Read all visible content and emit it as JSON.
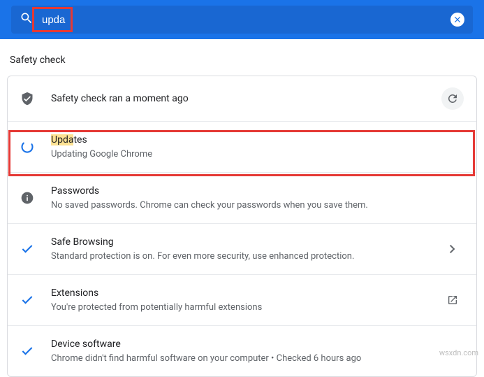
{
  "search": {
    "value": "upda"
  },
  "section": {
    "title": "Safety check"
  },
  "rows": {
    "safety": {
      "title": "Safety check ran a moment ago"
    },
    "updates": {
      "prefix": "Upda",
      "rest": "tes",
      "sub": "Updating Google Chrome"
    },
    "passwords": {
      "title": "Passwords",
      "sub": "No saved passwords. Chrome can check your passwords when you save them."
    },
    "browsing": {
      "title": "Safe Browsing",
      "sub": "Standard protection is on. For even more security, use enhanced protection."
    },
    "extensions": {
      "title": "Extensions",
      "sub": "You're protected from potentially harmful extensions"
    },
    "device": {
      "title": "Device software",
      "sub": "Chrome didn't find harmful software on your computer • Checked 6 hours ago"
    }
  },
  "watermark": "wsxdn.com"
}
